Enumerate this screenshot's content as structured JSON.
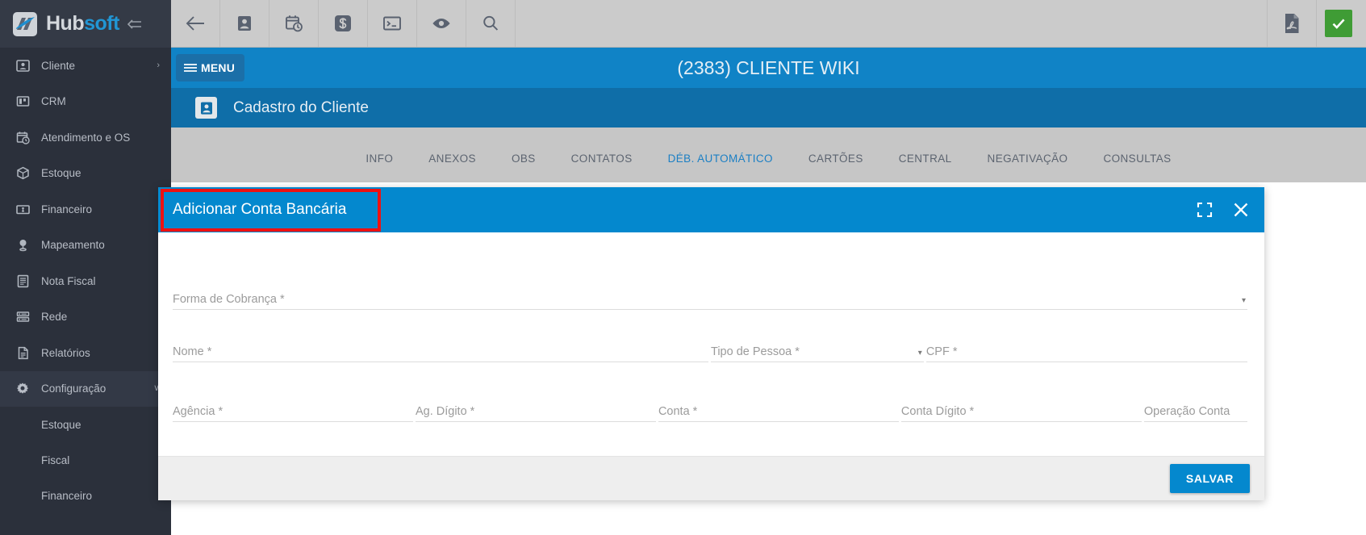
{
  "brand": {
    "name_part1": "Hub",
    "name_part2": "soft",
    "logo_icon": "hubsoft-logo-icon",
    "collapse_icon": "collapse-sidebar-icon"
  },
  "sidebar": {
    "items": [
      {
        "label": "Cliente",
        "icon": "contact-card-icon",
        "caret": "›",
        "active": false
      },
      {
        "label": "CRM",
        "icon": "kanban-board-icon",
        "caret": "",
        "active": false
      },
      {
        "label": "Atendimento e OS",
        "icon": "calendar-clock-icon",
        "caret": "",
        "active": false
      },
      {
        "label": "Estoque",
        "icon": "box-icon",
        "caret": "",
        "active": false
      },
      {
        "label": "Financeiro",
        "icon": "money-bill-icon",
        "caret": "",
        "active": false
      },
      {
        "label": "Mapeamento",
        "icon": "map-pin-icon",
        "caret": "",
        "active": false
      },
      {
        "label": "Nota Fiscal",
        "icon": "document-lines-icon",
        "caret": "",
        "active": false
      },
      {
        "label": "Rede",
        "icon": "server-rack-icon",
        "caret": "",
        "active": false
      },
      {
        "label": "Relatórios",
        "icon": "report-file-icon",
        "caret": "",
        "active": false
      },
      {
        "label": "Configuração",
        "icon": "gear-icon",
        "caret": "∨",
        "active": true
      }
    ],
    "subitems": [
      {
        "label": "Estoque"
      },
      {
        "label": "Fiscal"
      },
      {
        "label": "Financeiro"
      }
    ]
  },
  "toolbar": {
    "buttons": [
      {
        "icon": "back-arrow-icon"
      },
      {
        "icon": "contact-card-icon"
      },
      {
        "icon": "calendar-clock-icon"
      },
      {
        "icon": "dollar-sign-icon"
      },
      {
        "icon": "terminal-console-icon"
      },
      {
        "icon": "eye-icon"
      },
      {
        "icon": "search-icon"
      }
    ],
    "right_icon": "pdf-file-icon",
    "status_icon": "green-check-icon"
  },
  "header": {
    "menu_label": "MENU",
    "menu_icon": "hamburger-menu-icon",
    "client_title": "(2383) CLIENTE WIKI"
  },
  "subheader": {
    "icon": "contact-card-icon",
    "title": "Cadastro do Cliente"
  },
  "tabs": [
    {
      "label": "INFO",
      "active": false
    },
    {
      "label": "ANEXOS",
      "active": false
    },
    {
      "label": "OBS",
      "active": false
    },
    {
      "label": "CONTATOS",
      "active": false
    },
    {
      "label": "DÉB. AUTOMÁTICO",
      "active": true
    },
    {
      "label": "CARTÕES",
      "active": false
    },
    {
      "label": "CENTRAL",
      "active": false
    },
    {
      "label": "NEGATIVAÇÃO",
      "active": false
    },
    {
      "label": "CONSULTAS",
      "active": false
    }
  ],
  "dialog": {
    "title": "Adicionar Conta Bancária",
    "expand_icon": "fullscreen-expand-icon",
    "close_icon": "close-icon",
    "fields": {
      "forma_cobranca": {
        "label": "Forma de Cobrança",
        "required": "*",
        "value": "",
        "type": "select"
      },
      "nome": {
        "label": "Nome",
        "required": "*",
        "value": "",
        "type": "text"
      },
      "tipo_pessoa": {
        "label": "Tipo de Pessoa",
        "required": "*",
        "value": "",
        "type": "select"
      },
      "cpf": {
        "label": "CPF",
        "required": "*",
        "value": "",
        "type": "text"
      },
      "agencia": {
        "label": "Agência",
        "required": "*",
        "value": "",
        "type": "text"
      },
      "ag_digito": {
        "label": "Ag. Dígito",
        "required": "*",
        "value": "",
        "type": "text"
      },
      "conta": {
        "label": "Conta",
        "required": "*",
        "value": "",
        "type": "text"
      },
      "conta_digito": {
        "label": "Conta Dígito",
        "required": "*",
        "value": "",
        "type": "text"
      },
      "operacao_conta": {
        "label": "Operação Conta",
        "required": "",
        "value": "",
        "type": "text"
      }
    },
    "save_label": "SALVAR"
  },
  "colors": {
    "sidebar_bg": "#2b303b",
    "toolbar_bg": "#cbcbcb",
    "header_blue": "#1083c6",
    "subheader_blue": "#0f6ea8",
    "dialog_blue": "#0488ce",
    "accent_tab": "#1b7fc4",
    "annotation_red": "#ee1111",
    "status_green": "#3f9c35"
  }
}
